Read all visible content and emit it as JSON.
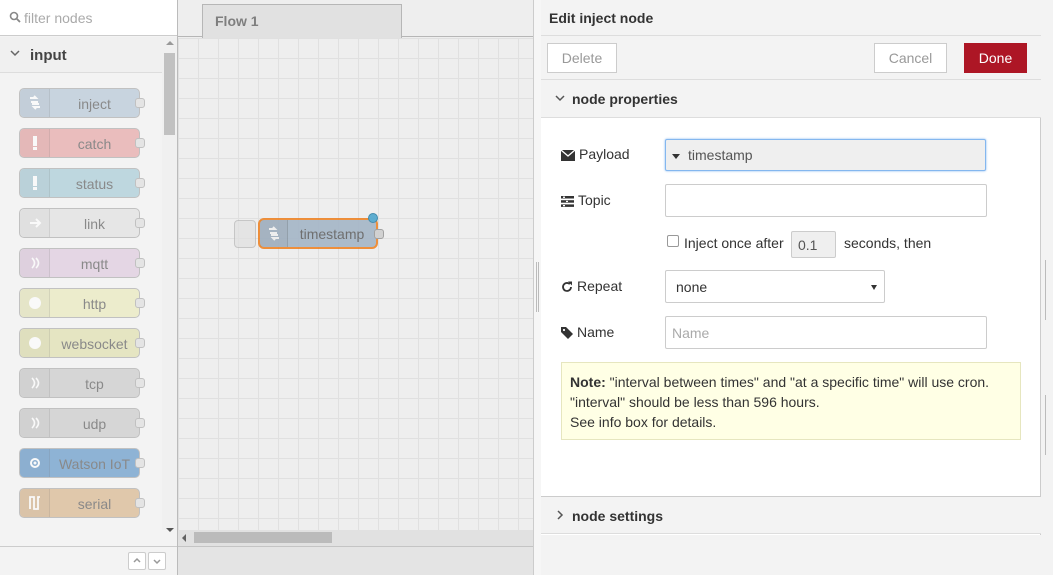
{
  "palette": {
    "search_placeholder": "filter nodes",
    "category": "input",
    "nodes": [
      {
        "label": "inject",
        "color": "#a6bbcf"
      },
      {
        "label": "catch",
        "color": "#e49191"
      },
      {
        "label": "status",
        "color": "#94c1d0"
      },
      {
        "label": "link",
        "color": "#dddddd"
      },
      {
        "label": "mqtt",
        "color": "#d8bfd8"
      },
      {
        "label": "http",
        "color": "#e7e7ae"
      },
      {
        "label": "websocket",
        "color": "#dbdb9b"
      },
      {
        "label": "tcp",
        "color": "#c0c0c0"
      },
      {
        "label": "udp",
        "color": "#c0c0c0"
      },
      {
        "label": "Watson IoT",
        "color": "#3d7fbe"
      },
      {
        "label": "serial",
        "color": "#d2a572"
      }
    ]
  },
  "workspace": {
    "tab_label": "Flow 1",
    "flow_node_label": "timestamp"
  },
  "tray": {
    "title": "Edit inject node",
    "delete_label": "Delete",
    "cancel_label": "Cancel",
    "done_label": "Done",
    "section_properties": "node properties",
    "section_settings": "node settings",
    "payload_label": "Payload",
    "payload_value": "timestamp",
    "topic_label": "Topic",
    "topic_value": "",
    "inject_once_label": "Inject once after",
    "inject_once_value": "0.1",
    "seconds_then": "seconds, then",
    "repeat_label": "Repeat",
    "repeat_value": "none",
    "name_label": "Name",
    "name_placeholder": "Name",
    "note_bold": "Note:",
    "note_line1": " \"interval between times\" and \"at a specific time\" will use cron.",
    "note_line2": "\"interval\" should be less than 596 hours.",
    "note_line3": "See info box for details."
  },
  "colors": {
    "done_button": "#ad1625",
    "selected_node_border": "#ff7f0e",
    "changed_badge": "#3ca8d8",
    "note_background": "#ffffe5"
  }
}
